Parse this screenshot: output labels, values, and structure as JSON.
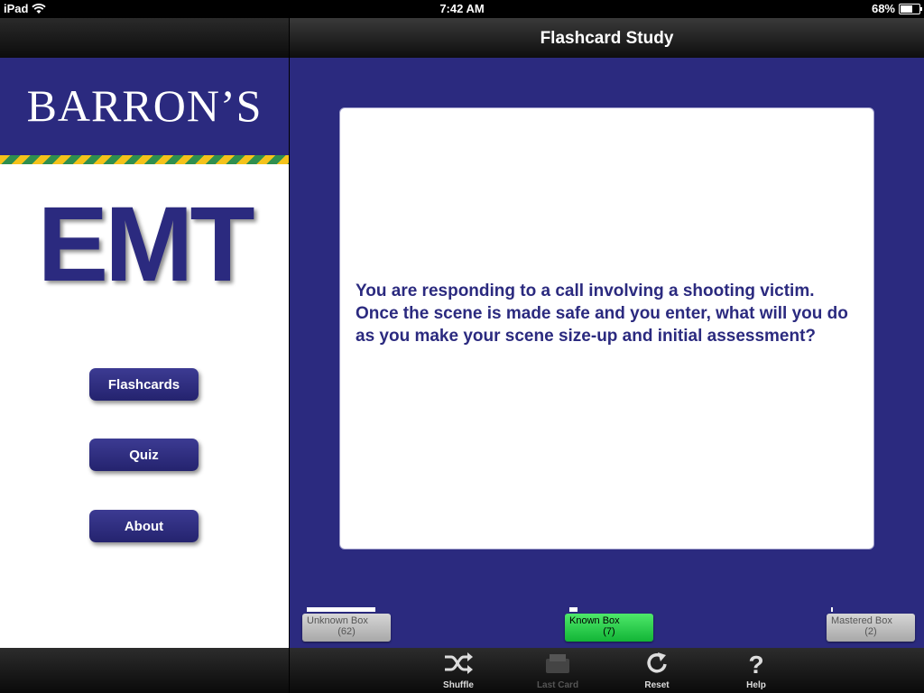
{
  "status": {
    "device": "iPad",
    "time": "7:42 AM",
    "battery": "68%",
    "battery_level": 0.68
  },
  "nav": {
    "title": "Flashcard Study"
  },
  "sidebar": {
    "logo": "BARRON’S",
    "product": "EMT",
    "buttons": [
      "Flashcards",
      "Quiz",
      "About"
    ]
  },
  "card": {
    "question": "You are responding to a call involving a shooting victim. Once the scene is made safe and you enter, what will you do as you make your scene size-up and initial assessment?"
  },
  "boxes": {
    "unknown": {
      "label": "Unknown Box",
      "count": "(62)"
    },
    "known": {
      "label": "Known Box",
      "count": "(7)"
    },
    "mastered": {
      "label": "Mastered Box",
      "count": "(2)"
    }
  },
  "toolbar": {
    "shuffle": "Shuffle",
    "last_card": "Last Card",
    "reset": "Reset",
    "help": "Help"
  },
  "colors": {
    "brand_navy": "#2b2a7f",
    "known_green": "#1fc63f"
  }
}
